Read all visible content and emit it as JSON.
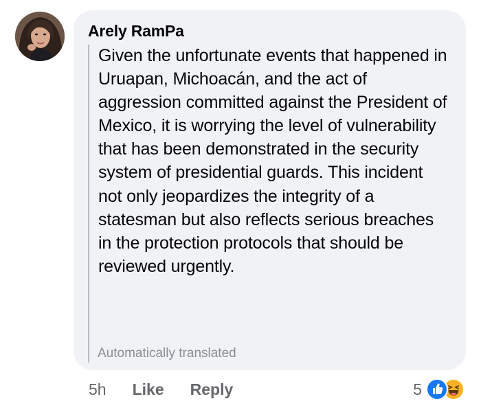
{
  "comment": {
    "author": "Arely RamPa",
    "text": "Given the unfortunate events that happened in Uruapan, Michoacán, and the act of aggression committed against the President of Mexico, it is worrying the level of vulnerability that has been demonstrated in the security system of presidential guards. This incident not only jeopardizes the integrity of a statesman but also reflects serious breaches in the protection protocols that should be reviewed urgently.",
    "translation_note": "Automatically translated",
    "timestamp": "5h",
    "like_label": "Like",
    "reply_label": "Reply",
    "reaction_count": "5",
    "reactions": [
      "like-icon",
      "haha-icon"
    ]
  },
  "colors": {
    "bubble": "#f0f2f5",
    "like_blue": "#1877f2",
    "haha_yellow": "#f7b125",
    "meta_gray": "#65676b"
  }
}
